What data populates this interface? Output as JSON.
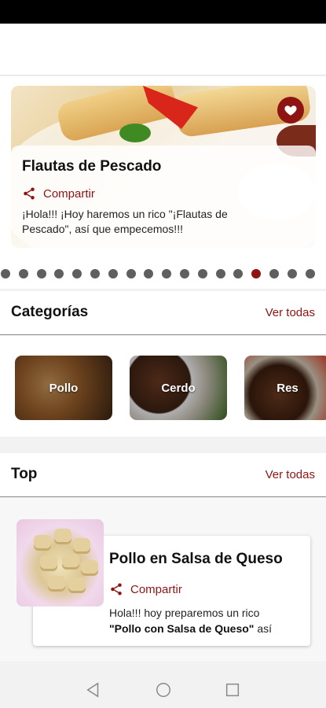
{
  "featured": {
    "title": "Flautas de Pescado",
    "share_label": "Compartir",
    "description": "¡Hola!!! ¡Hoy haremos un rico \"¡Flautas de Pescado\", así que empecemos!!!",
    "favorite_icon": "heart-icon"
  },
  "carousel": {
    "total_dots": 18,
    "active_index": 14
  },
  "categories": {
    "title": "Categorías",
    "see_all": "Ver todas",
    "items": [
      {
        "label": "Pollo"
      },
      {
        "label": "Cerdo"
      },
      {
        "label": "Res"
      }
    ]
  },
  "top": {
    "title": "Top",
    "see_all": "Ver todas",
    "recipe": {
      "title": "Pollo en Salsa de Queso",
      "share_label": "Compartir",
      "desc_prefix": "Hola!!! hoy preparemos un rico",
      "desc_bold": "\"Pollo con Salsa de Queso\"",
      "desc_suffix": " así"
    }
  },
  "colors": {
    "accent": "#8e1414",
    "background": "#f2f2f2"
  },
  "nav": {
    "back_icon": "back-triangle-icon",
    "home_icon": "home-circle-icon",
    "recents_icon": "recents-square-icon"
  }
}
